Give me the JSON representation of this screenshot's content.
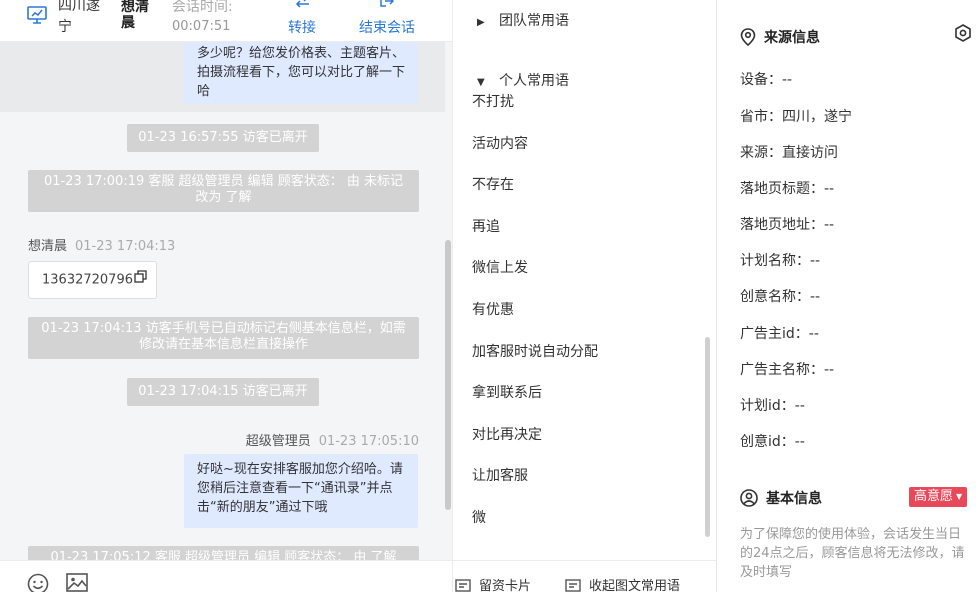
{
  "header": {
    "visitor_location": "四川遂宁",
    "customer_name": "想清晨",
    "session_time_label": "会话时间:",
    "session_time": "00:07:51",
    "transfer_label": "转接",
    "end_label": "结束会话"
  },
  "messages": [
    {
      "kind": "agent",
      "text": "多少呢？给您发价格表、主题客片、拍摄流程看下，您可以对比了解一下哈"
    },
    {
      "kind": "system",
      "text": "01-23 16:57:55 访客已离开"
    },
    {
      "kind": "system",
      "text": "01-23 17:00:19 客服 超级管理员 编辑 顾客状态： 由 未标记 改为 了解"
    },
    {
      "kind": "visitor_meta",
      "name": "想清晨",
      "time": "01-23 17:04:13"
    },
    {
      "kind": "visitor_phone",
      "text": "13632720796"
    },
    {
      "kind": "system",
      "text": "01-23 17:04:13 访客手机号已自动标记右侧基本信息栏，如需修改请在基本信息栏直接操作"
    },
    {
      "kind": "system",
      "text": "01-23 17:04:15 访客已离开"
    },
    {
      "kind": "agent_meta",
      "name": "超级管理员",
      "time": "01-23 17:05:10"
    },
    {
      "kind": "agent",
      "text": "好哒~现在安排客服加您介绍哈。请您稍后注意查看一下“通讯录”并点击“新的朋友”通过下哦"
    },
    {
      "kind": "system",
      "text": "01-23 17:05:12 客服 超级管理员 编辑 顾客状态： 由 了解"
    }
  ],
  "chat_footer": {
    "icons": [
      "emoji-icon",
      "image-icon"
    ]
  },
  "phrases": {
    "team_group": "团队常用语",
    "personal_group": "个人常用语",
    "items": [
      "不打扰",
      "活动内容",
      "不存在",
      "再追",
      "微信上发",
      "有优惠",
      "加客服时说自动分配",
      "拿到联系后",
      "对比再决定",
      "让加客服",
      "微"
    ],
    "footer_card": "留资卡片",
    "footer_collect": "收起图文常用语"
  },
  "source_info": {
    "title": "来源信息",
    "fields": [
      {
        "label": "设备：",
        "value": "--"
      },
      {
        "label": "省市：",
        "value": "四川，遂宁"
      },
      {
        "label": "来源：",
        "value": "直接访问"
      },
      {
        "label": "落地页标题：",
        "value": "--"
      },
      {
        "label": "落地页地址：",
        "value": "--"
      },
      {
        "label": "计划名称：",
        "value": "--"
      },
      {
        "label": "创意名称：",
        "value": "--"
      },
      {
        "label": "广告主id：",
        "value": "--"
      },
      {
        "label": "广告主名称：",
        "value": "--"
      },
      {
        "label": "计划id：",
        "value": "--"
      },
      {
        "label": "创意id：",
        "value": "--"
      }
    ]
  },
  "basic_info": {
    "title": "基本信息",
    "intent_badge": "高意愿",
    "notice": "为了保障您的使用体验，会话发生当日的24点之后，顾客信息将无法修改，请及时填写"
  },
  "colors": {
    "link_blue": "#2b78d6",
    "bubble_blue": "#dfe9ff",
    "system_gray": "#d3d3d3",
    "badge_red": "#e8495a"
  }
}
